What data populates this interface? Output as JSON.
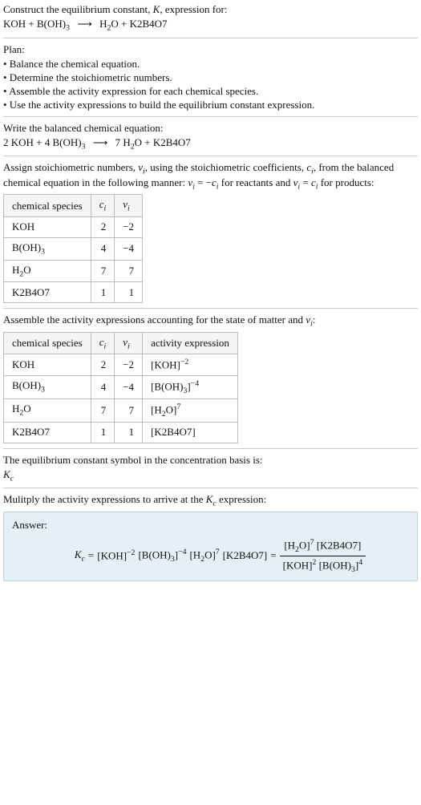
{
  "intro": {
    "line1_a": "Construct the equilibrium constant, ",
    "line1_K": "K",
    "line1_b": ", expression for:",
    "eq_lhs": "KOH + B(OH)",
    "eq_lhs_sub": "3",
    "arrow": "⟶",
    "eq_rhs_a": "H",
    "eq_rhs_a_sub": "2",
    "eq_rhs_b": "O + K2B4O7"
  },
  "plan": {
    "title": "Plan:",
    "b1": "• Balance the chemical equation.",
    "b2": "• Determine the stoichiometric numbers.",
    "b3": "• Assemble the activity expression for each chemical species.",
    "b4": "• Use the activity expressions to build the equilibrium constant expression."
  },
  "balanced": {
    "title": "Write the balanced chemical equation:",
    "lhs_a": "2 KOH + 4 B(OH)",
    "lhs_sub": "3",
    "arrow": "⟶",
    "rhs_a": "7 H",
    "rhs_a_sub": "2",
    "rhs_b": "O + K2B4O7"
  },
  "assign": {
    "p1a": "Assign stoichiometric numbers, ",
    "nu": "ν",
    "i": "i",
    "p1b": ", using the stoichiometric coefficients, ",
    "c": "c",
    "p1c": ", from the balanced chemical equation in the following manner: ",
    "rel1": " = −",
    "p1d": " for reactants and ",
    "rel2": " = ",
    "p1e": " for products:"
  },
  "table1": {
    "h1": "chemical species",
    "h2_c": "c",
    "h2_i": "i",
    "h3_n": "ν",
    "h3_i": "i",
    "r1": {
      "sp_a": "KOH",
      "c": "2",
      "n": "−2"
    },
    "r2": {
      "sp_a": "B(OH)",
      "sp_sub": "3",
      "c": "4",
      "n": "−4"
    },
    "r3": {
      "sp_a": "H",
      "sp_sub": "2",
      "sp_b": "O",
      "c": "7",
      "n": "7"
    },
    "r4": {
      "sp_a": "K2B4O7",
      "c": "1",
      "n": "1"
    }
  },
  "assemble_line_a": "Assemble the activity expressions accounting for the state of matter and ",
  "assemble_line_b": ":",
  "table2": {
    "h1": "chemical species",
    "h2_c": "c",
    "h2_i": "i",
    "h3_n": "ν",
    "h3_i": "i",
    "h4": "activity expression",
    "r1": {
      "sp": "KOH",
      "c": "2",
      "n": "−2",
      "ae_a": "[KOH]",
      "ae_sup": "−2"
    },
    "r2": {
      "sp_a": "B(OH)",
      "sp_sub": "3",
      "c": "4",
      "n": "−4",
      "ae_a": "[B(OH)",
      "ae_sub": "3",
      "ae_b": "]",
      "ae_sup": "−4"
    },
    "r3": {
      "sp_a": "H",
      "sp_sub": "2",
      "sp_b": "O",
      "c": "7",
      "n": "7",
      "ae_a": "[H",
      "ae_sub": "2",
      "ae_b": "O]",
      "ae_sup": "7"
    },
    "r4": {
      "sp": "K2B4O7",
      "c": "1",
      "n": "1",
      "ae": "[K2B4O7]"
    }
  },
  "basis": {
    "line": "The equilibrium constant symbol in the concentration basis is:",
    "K": "K",
    "c": "c"
  },
  "mult": {
    "a": "Mulitply the activity expressions to arrive at the ",
    "K": "K",
    "c": "c",
    "b": " expression:"
  },
  "answer": {
    "label": "Answer:",
    "K": "K",
    "c": "c",
    "eq": " = ",
    "t1": "[KOH]",
    "t1s": "−2",
    "sp": " ",
    "t2a": "[B(OH)",
    "t2sub": "3",
    "t2b": "]",
    "t2s": "−4",
    "t3a": "[H",
    "t3sub": "2",
    "t3b": "O]",
    "t3s": "7",
    "t4": "[K2B4O7]",
    "eq2": " = ",
    "num_a": "[H",
    "num_asub": "2",
    "num_ab": "O]",
    "num_as": "7",
    "num_b": " [K2B4O7]",
    "den_a": "[KOH]",
    "den_as": "2",
    "den_b": " [B(OH)",
    "den_bsub": "3",
    "den_bb": "]",
    "den_bs": "4"
  }
}
